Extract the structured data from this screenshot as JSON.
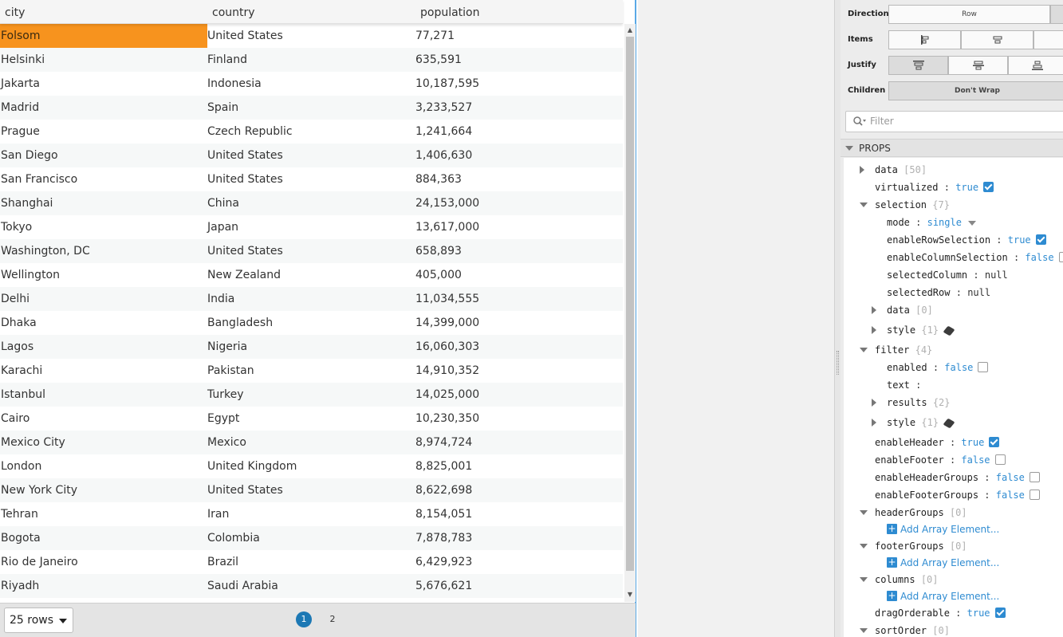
{
  "table": {
    "columns": [
      "city",
      "country",
      "population"
    ],
    "rows": [
      [
        "Folsom",
        "United States",
        "77,271"
      ],
      [
        "Helsinki",
        "Finland",
        "635,591"
      ],
      [
        "Jakarta",
        "Indonesia",
        "10,187,595"
      ],
      [
        "Madrid",
        "Spain",
        "3,233,527"
      ],
      [
        "Prague",
        "Czech Republic",
        "1,241,664"
      ],
      [
        "San Diego",
        "United States",
        "1,406,630"
      ],
      [
        "San Francisco",
        "United States",
        "884,363"
      ],
      [
        "Shanghai",
        "China",
        "24,153,000"
      ],
      [
        "Tokyo",
        "Japan",
        "13,617,000"
      ],
      [
        "Washington, DC",
        "United States",
        "658,893"
      ],
      [
        "Wellington",
        "New Zealand",
        "405,000"
      ],
      [
        "Delhi",
        "India",
        "11,034,555"
      ],
      [
        "Dhaka",
        "Bangladesh",
        "14,399,000"
      ],
      [
        "Lagos",
        "Nigeria",
        "16,060,303"
      ],
      [
        "Karachi",
        "Pakistan",
        "14,910,352"
      ],
      [
        "Istanbul",
        "Turkey",
        "14,025,000"
      ],
      [
        "Cairo",
        "Egypt",
        "10,230,350"
      ],
      [
        "Mexico City",
        "Mexico",
        "8,974,724"
      ],
      [
        "London",
        "United Kingdom",
        "8,825,001"
      ],
      [
        "New York City",
        "United States",
        "8,622,698"
      ],
      [
        "Tehran",
        "Iran",
        "8,154,051"
      ],
      [
        "Bogota",
        "Colombia",
        "7,878,783"
      ],
      [
        "Rio de Janeiro",
        "Brazil",
        "6,429,923"
      ],
      [
        "Riyadh",
        "Saudi Arabia",
        "5,676,621"
      ]
    ],
    "selected_row": 0,
    "selected_column": 0
  },
  "pager": {
    "rows_per_page": "25 rows",
    "pages": [
      "1",
      "2"
    ],
    "current_page": "1"
  },
  "layout_controls": {
    "direction": {
      "label": "Direction",
      "value": "Row"
    },
    "items": {
      "label": "Items"
    },
    "justify": {
      "label": "Justify"
    },
    "children": {
      "label": "Children",
      "value": "Don't Wrap"
    }
  },
  "filter": {
    "placeholder": "Filter"
  },
  "props": {
    "section_label": "PROPS",
    "data": {
      "key": "data",
      "count": "[50]"
    },
    "virtualized": {
      "key": "virtualized",
      "value": "true"
    },
    "selection": {
      "key": "selection",
      "count": "{7}"
    },
    "mode": {
      "key": "mode",
      "value": "single"
    },
    "enableRowSelection": {
      "key": "enableRowSelection",
      "value": "true"
    },
    "enableColumnSelection": {
      "key": "enableColumnSelection",
      "value": "false"
    },
    "selectedColumn": {
      "key": "selectedColumn",
      "value": "null"
    },
    "selectedRow": {
      "key": "selectedRow",
      "value": "null"
    },
    "selection_data": {
      "key": "data",
      "count": "[0]"
    },
    "selection_style": {
      "key": "style",
      "count": "{1}"
    },
    "filter": {
      "key": "filter",
      "count": "{4}"
    },
    "enabled": {
      "key": "enabled",
      "value": "false"
    },
    "text": {
      "key": "text",
      "value": ""
    },
    "results": {
      "key": "results",
      "count": "{2}"
    },
    "filter_style": {
      "key": "style",
      "count": "{1}"
    },
    "enableHeader": {
      "key": "enableHeader",
      "value": "true"
    },
    "enableFooter": {
      "key": "enableFooter",
      "value": "false"
    },
    "enableHeaderGroups": {
      "key": "enableHeaderGroups",
      "value": "false"
    },
    "enableFooterGroups": {
      "key": "enableFooterGroups",
      "value": "false"
    },
    "headerGroups": {
      "key": "headerGroups",
      "count": "[0]"
    },
    "footerGroups": {
      "key": "footerGroups",
      "count": "[0]"
    },
    "columns": {
      "key": "columns",
      "count": "[0]"
    },
    "add_array_element": "Add Array Element...",
    "dragOrderable": {
      "key": "dragOrderable",
      "value": "true"
    },
    "sortOrder": {
      "key": "sortOrder",
      "count": "[0]"
    },
    "colon": ":"
  }
}
